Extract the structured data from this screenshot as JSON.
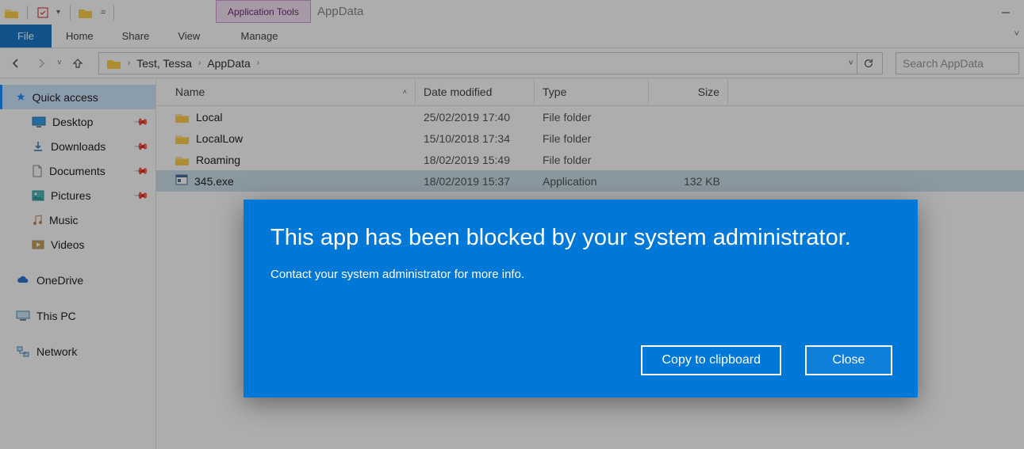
{
  "title": "AppData",
  "app_tools_label": "Application Tools",
  "ribbon": {
    "file": "File",
    "home": "Home",
    "share": "Share",
    "view": "View",
    "manage": "Manage"
  },
  "breadcrumb": {
    "segments": [
      "Test, Tessa",
      "AppData"
    ],
    "dropdown_hint": "v"
  },
  "search": {
    "placeholder": "Search AppData"
  },
  "nav": {
    "quick_access": "Quick access",
    "items": [
      {
        "label": "Desktop",
        "pinned": true
      },
      {
        "label": "Downloads",
        "pinned": true
      },
      {
        "label": "Documents",
        "pinned": true
      },
      {
        "label": "Pictures",
        "pinned": true
      },
      {
        "label": "Music",
        "pinned": false
      },
      {
        "label": "Videos",
        "pinned": false
      }
    ],
    "onedrive": "OneDrive",
    "this_pc": "This PC",
    "network": "Network"
  },
  "columns": {
    "name": "Name",
    "date": "Date modified",
    "type": "Type",
    "size": "Size"
  },
  "rows": [
    {
      "name": "Local",
      "date": "25/02/2019 17:40",
      "type": "File folder",
      "size": "",
      "kind": "folder"
    },
    {
      "name": "LocalLow",
      "date": "15/10/2018 17:34",
      "type": "File folder",
      "size": "",
      "kind": "folder"
    },
    {
      "name": "Roaming",
      "date": "18/02/2019 15:49",
      "type": "File folder",
      "size": "",
      "kind": "folder"
    },
    {
      "name": "345.exe",
      "date": "18/02/2019 15:37",
      "type": "Application",
      "size": "132 KB",
      "kind": "exe",
      "selected": true
    }
  ],
  "dialog": {
    "heading": "This app has been blocked by your system administrator.",
    "body": "Contact your system administrator for more info.",
    "copy": "Copy to clipboard",
    "close": "Close"
  }
}
